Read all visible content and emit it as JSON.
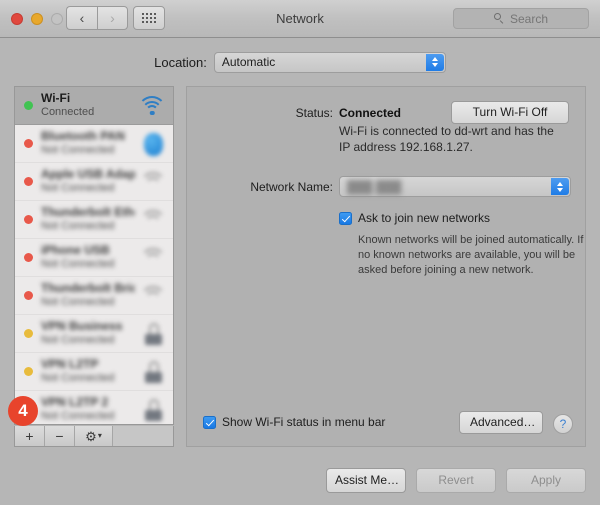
{
  "window": {
    "title": "Network",
    "traffic_lights": [
      "close",
      "minimize",
      "zoom"
    ],
    "nav_back_icon": "chevron-left-icon",
    "nav_forward_icon": "chevron-right-icon",
    "grid_icon": "show-all-grid-icon",
    "search": {
      "placeholder": "Search",
      "icon": "search-icon"
    }
  },
  "location": {
    "label": "Location:",
    "value": "Automatic"
  },
  "sidebar": {
    "services": [
      {
        "name": "Wi-Fi",
        "status": "Connected",
        "dot": "green",
        "icon": "wifi-icon",
        "selected": true,
        "blurred": false
      },
      {
        "name": "Bluetooth PAN",
        "status": "Not Connected",
        "dot": "red",
        "icon": "bluetooth-icon",
        "selected": false,
        "blurred": true
      },
      {
        "name": "Apple USB Adapter",
        "status": "Not Connected",
        "dot": "red",
        "icon": "wifi-arcs-icon",
        "selected": false,
        "blurred": true
      },
      {
        "name": "Thunderbolt Ethernet",
        "status": "Not Connected",
        "dot": "red",
        "icon": "wifi-arcs-icon",
        "selected": false,
        "blurred": true
      },
      {
        "name": "iPhone USB",
        "status": "Not Connected",
        "dot": "red",
        "icon": "wifi-arcs-icon",
        "selected": false,
        "blurred": true
      },
      {
        "name": "Thunderbolt Bridge",
        "status": "Not Connected",
        "dot": "red",
        "icon": "wifi-arcs-icon",
        "selected": false,
        "blurred": true
      },
      {
        "name": "VPN Business",
        "status": "Not Connected",
        "dot": "yellow",
        "icon": "lock-icon",
        "selected": false,
        "blurred": true
      },
      {
        "name": "VPN L2TP",
        "status": "Not Connected",
        "dot": "yellow",
        "icon": "lock-icon",
        "selected": false,
        "blurred": true
      },
      {
        "name": "VPN L2TP 2",
        "status": "Not Connected",
        "dot": "yellow",
        "icon": "lock-icon",
        "selected": false,
        "blurred": true
      }
    ],
    "toolbar": {
      "add_label": "+",
      "remove_label": "−",
      "gear_label": "⚙",
      "gear_chevron": "▾"
    },
    "badge": {
      "number": "4",
      "color": "#e8442c"
    }
  },
  "detail": {
    "status_label": "Status:",
    "status_value": "Connected",
    "turn_off_button": "Turn Wi-Fi Off",
    "status_description": "Wi-Fi is connected to dd-wrt and has the IP address 192.168.1.27.",
    "network_name_label": "Network Name:",
    "network_name_value": "███ ███",
    "ask_to_join_label": "Ask to join new networks",
    "ask_to_join_checked": true,
    "ask_to_join_description": "Known networks will be joined automatically. If no known networks are available, you will be asked before joining a new network.",
    "show_status_label": "Show Wi-Fi status in menu bar",
    "show_status_checked": true,
    "advanced_button": "Advanced…",
    "help_button": "?"
  },
  "footer": {
    "assist_me": "Assist Me…",
    "revert": "Revert",
    "apply": "Apply"
  }
}
